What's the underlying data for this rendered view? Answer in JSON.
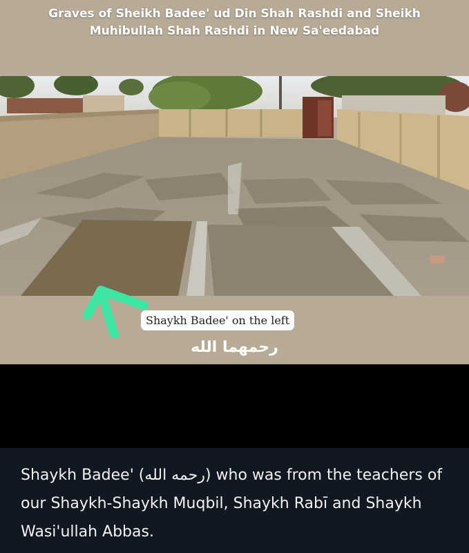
{
  "image": {
    "title": "Graves of Sheikh Badee' ud Din Shah Rashdi and Sheikh\nMuhibullah Shah Rashdi in New Sa'eedabad",
    "caption": "Shaykh Badee' on the left",
    "arabic_text": "رحمهما الله",
    "arrow_color": "#3ee6a4",
    "arrow_icon": "arrow-up-icon"
  },
  "description": {
    "text": "Shaykh Badee' (رحمه الله) who was from the teachers of our Shaykh-Shaykh Muqbil, Shaykh Rabī and Shaykh Wasi'ullah Abbas."
  },
  "colors": {
    "panel_background": "#111821",
    "image_background": "#b7ab98"
  }
}
